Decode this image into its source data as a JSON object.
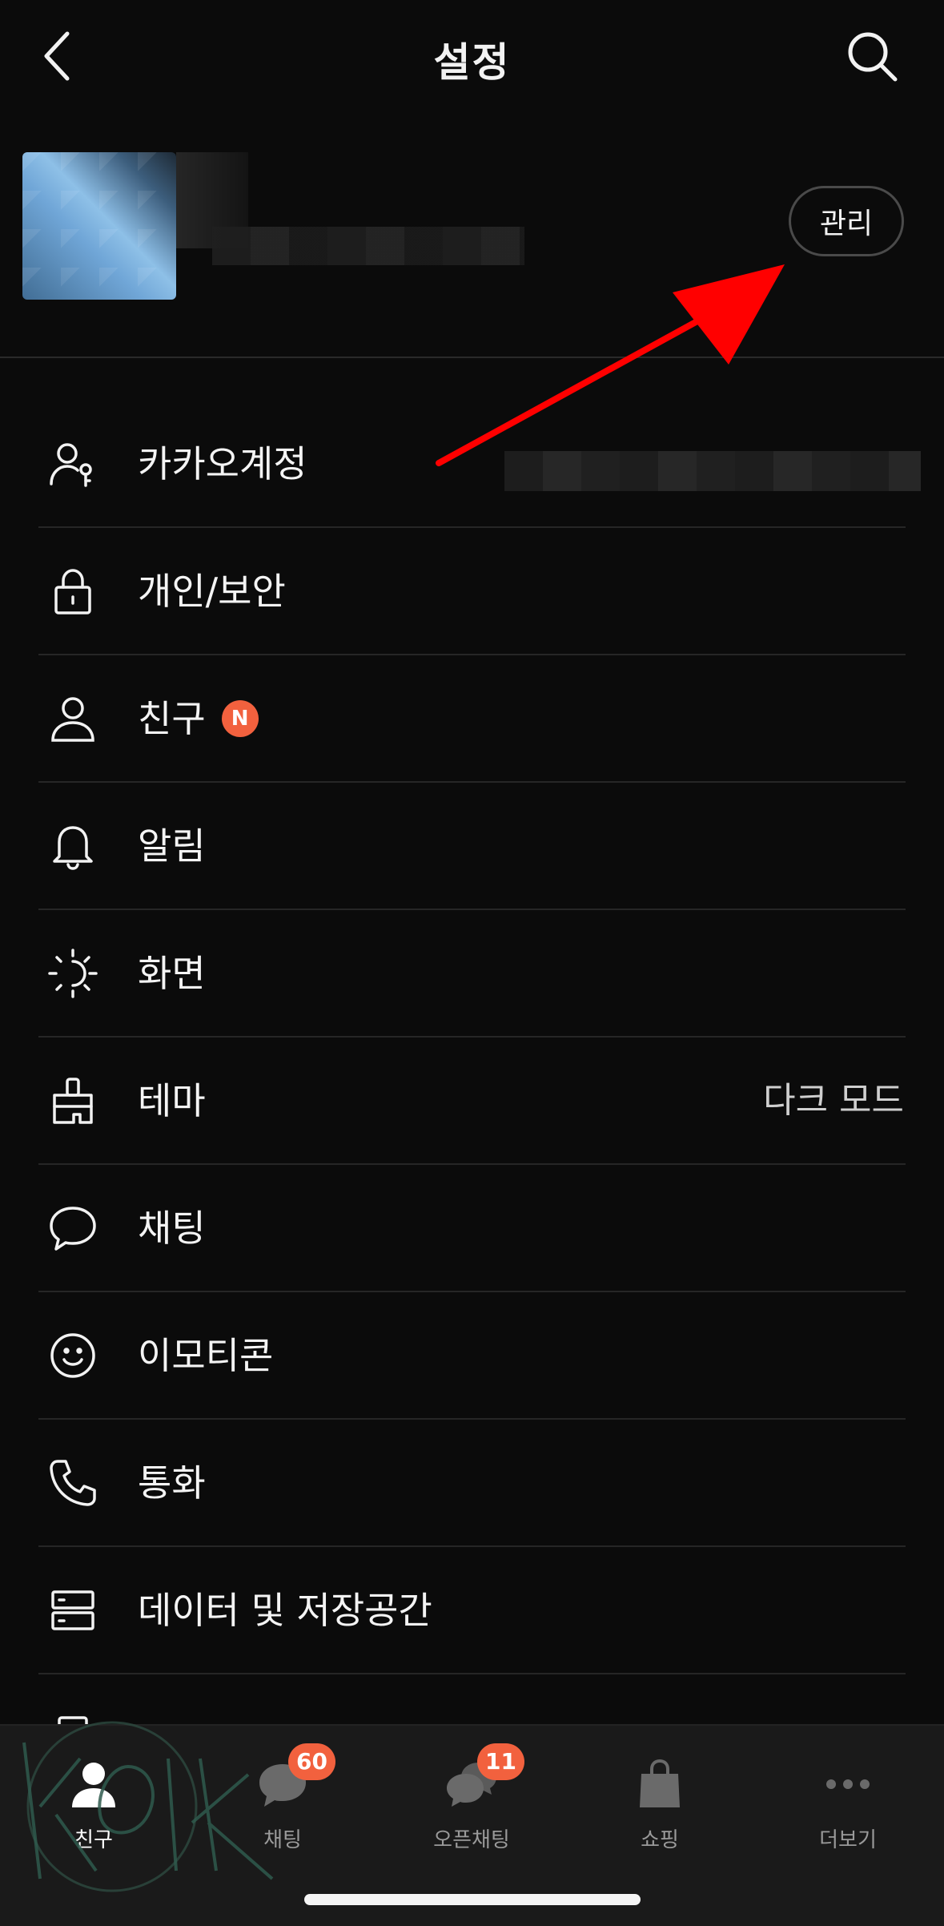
{
  "header": {
    "title": "설정"
  },
  "profile": {
    "manage_label": "관리"
  },
  "menu": [
    {
      "name": "account",
      "icon": "person-key-icon",
      "label": "카카오계정"
    },
    {
      "name": "privacy",
      "icon": "lock-icon",
      "label": "개인/보안"
    },
    {
      "name": "friends",
      "icon": "person-icon",
      "label": "친구",
      "badge": "N"
    },
    {
      "name": "notifications",
      "icon": "bell-icon",
      "label": "알림"
    },
    {
      "name": "display",
      "icon": "brightness-icon",
      "label": "화면"
    },
    {
      "name": "theme",
      "icon": "brush-icon",
      "label": "테마",
      "value": "다크 모드"
    },
    {
      "name": "chat",
      "icon": "chat-bubble-icon",
      "label": "채팅"
    },
    {
      "name": "emoticon",
      "icon": "smiley-icon",
      "label": "이모티콘"
    },
    {
      "name": "call",
      "icon": "phone-icon",
      "label": "통화"
    },
    {
      "name": "data-storage",
      "icon": "storage-icon",
      "label": "데이터 및 저장공간"
    }
  ],
  "tabbar": [
    {
      "name": "friends",
      "label": "친구",
      "icon": "person-icon",
      "active": true
    },
    {
      "name": "chats",
      "label": "채팅",
      "icon": "chat-bubble-icon",
      "badge": "60"
    },
    {
      "name": "openchat",
      "label": "오픈채팅",
      "icon": "double-chat-icon",
      "badge": "11"
    },
    {
      "name": "shopping",
      "label": "쇼핑",
      "icon": "shopping-bag-icon"
    },
    {
      "name": "more",
      "label": "더보기",
      "icon": "more-dots-icon"
    }
  ],
  "colors": {
    "background": "#0b0b0b",
    "accent_badge": "#f2613e",
    "annotation_arrow": "#ff0000"
  }
}
